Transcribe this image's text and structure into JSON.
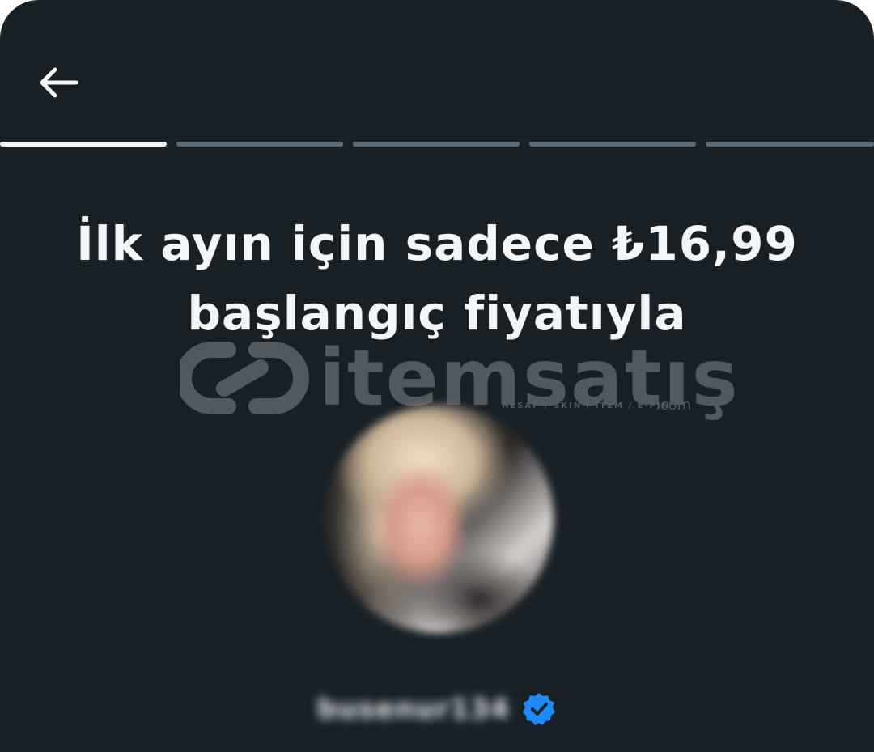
{
  "header": {
    "back_icon": "arrow-left-icon"
  },
  "progress": {
    "total_steps": 5,
    "current_step": 1
  },
  "offer": {
    "headline_line1": "İlk ayın için sadece ₺16,99",
    "headline_line2": "başlangıç fiyatıyla"
  },
  "watermark": {
    "brand": "itemsatış",
    "tagline": "HESAP / SKIN / ITEM / E-PIN",
    "domain": ".com"
  },
  "profile": {
    "username": "busenur134",
    "verified_icon": "verified-badge-icon"
  },
  "colors": {
    "background": "#182026",
    "progress_active": "#f1f3f5",
    "progress_inactive": "#5c6b78",
    "verified_blue": "#1d8cf8"
  }
}
